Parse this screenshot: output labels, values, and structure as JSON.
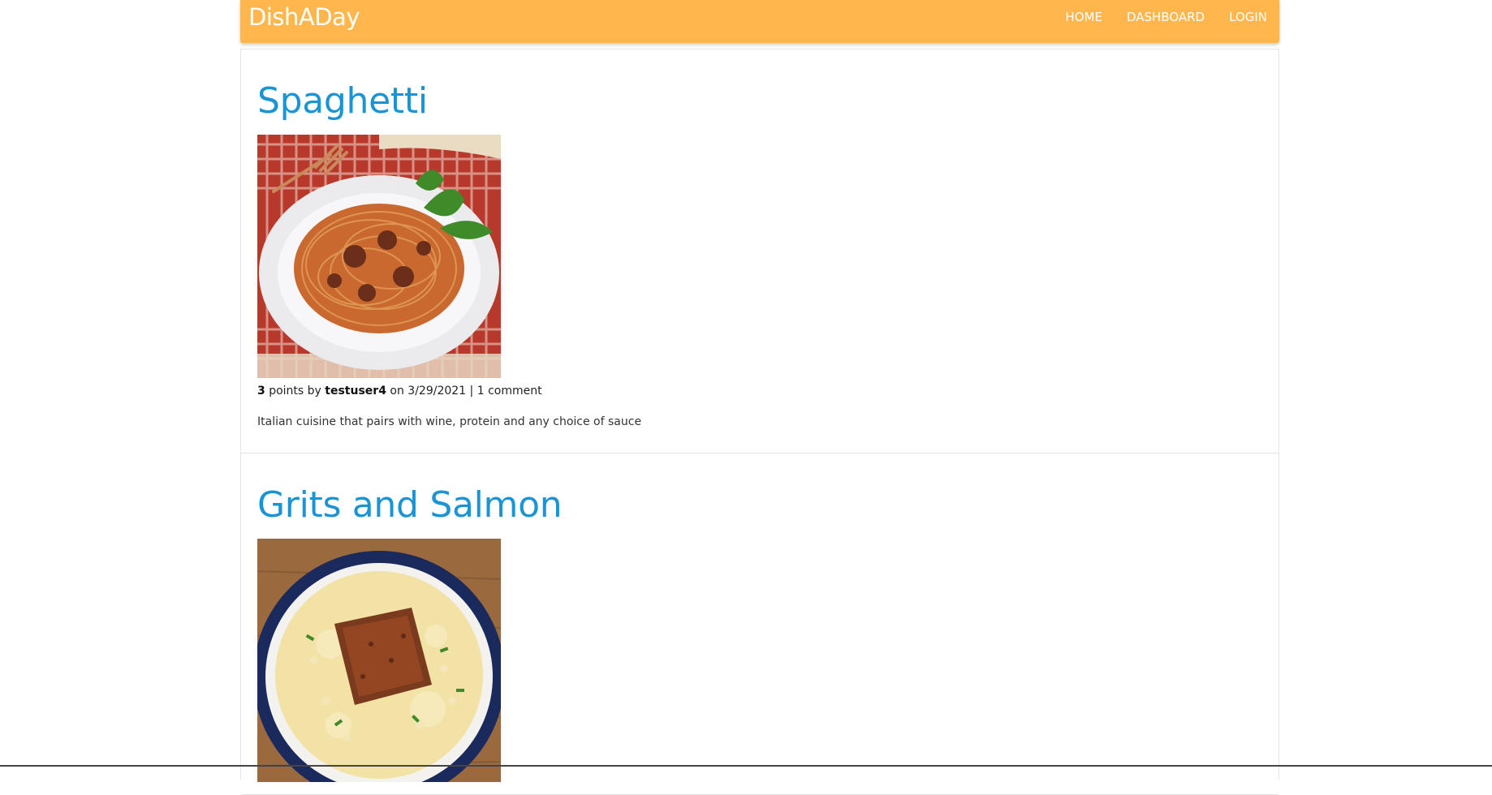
{
  "header": {
    "brand": "DishADay",
    "nav": [
      {
        "label": "HOME"
      },
      {
        "label": "DASHBOARD"
      },
      {
        "label": "LOGIN"
      }
    ],
    "bg_color": "#ffb74d"
  },
  "posts": [
    {
      "title": "Spaghetti",
      "points": "3",
      "points_word": "points by",
      "author": "testuser4",
      "date_prefix": "on",
      "date": "3/29/2021",
      "separator": "|",
      "comments": "1 comment",
      "description": "Italian cuisine that pairs with wine, protein and any choice of sauce",
      "image": "spaghetti-image"
    },
    {
      "title": "Grits and Salmon",
      "image": "grits-salmon-image"
    }
  ],
  "colors": {
    "title_link": "#1a94d4",
    "border": "#e4e4e4"
  }
}
